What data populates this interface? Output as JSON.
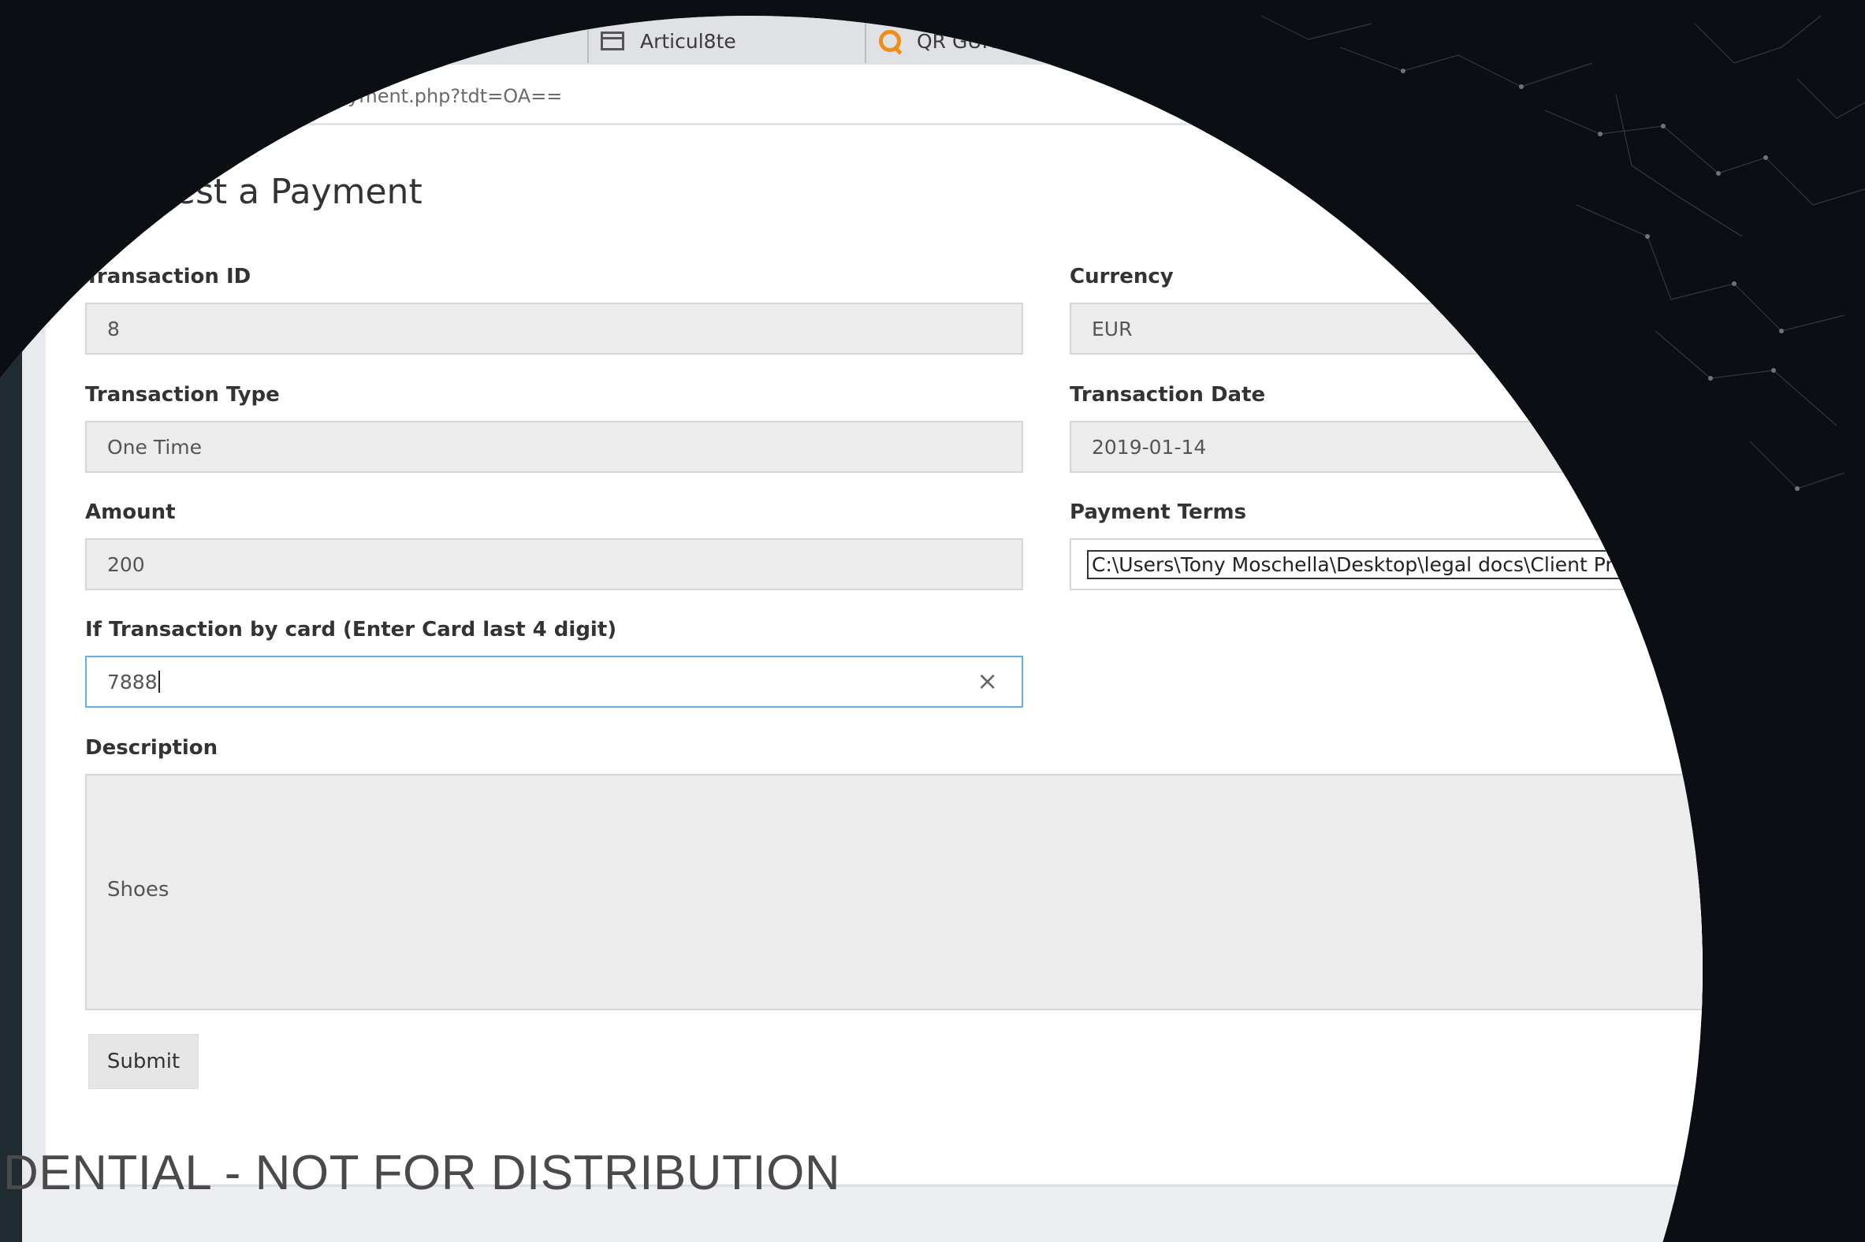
{
  "browser": {
    "tabs": [
      {
        "label": "Articul8te",
        "icon": "window-icon"
      },
      {
        "label": "QR GURU",
        "icon": "qr-guru-logo-icon"
      }
    ],
    "url": "m/send_payment.php?tdt=OA=="
  },
  "form": {
    "title": "equest a Payment",
    "fields": {
      "transaction_id": {
        "label": "Transaction ID",
        "value": "8"
      },
      "currency": {
        "label": "Currency",
        "value": "EUR"
      },
      "transaction_type": {
        "label": "Transaction Type",
        "value": "One Time"
      },
      "transaction_date": {
        "label": "Transaction Date",
        "value": "2019-01-14"
      },
      "amount": {
        "label": "Amount",
        "value": "200"
      },
      "payment_terms": {
        "label": "Payment Terms",
        "value": "C:\\Users\\Tony Moschella\\Desktop\\legal docs\\Client Prospect Form.pdf"
      },
      "card_last4": {
        "label": "If Transaction by card (Enter Card last 4 digit)",
        "value": "7888"
      },
      "description": {
        "label": "Description",
        "value": "Shoes"
      }
    },
    "submit_label": "Submit"
  },
  "watermark": "DENTIAL - NOT FOR DISTRIBUTION",
  "colors": {
    "background": "#0b0e12",
    "focus_border": "#66afe9",
    "field_bg": "#ececec",
    "qr_icon": "#f08c1a"
  }
}
